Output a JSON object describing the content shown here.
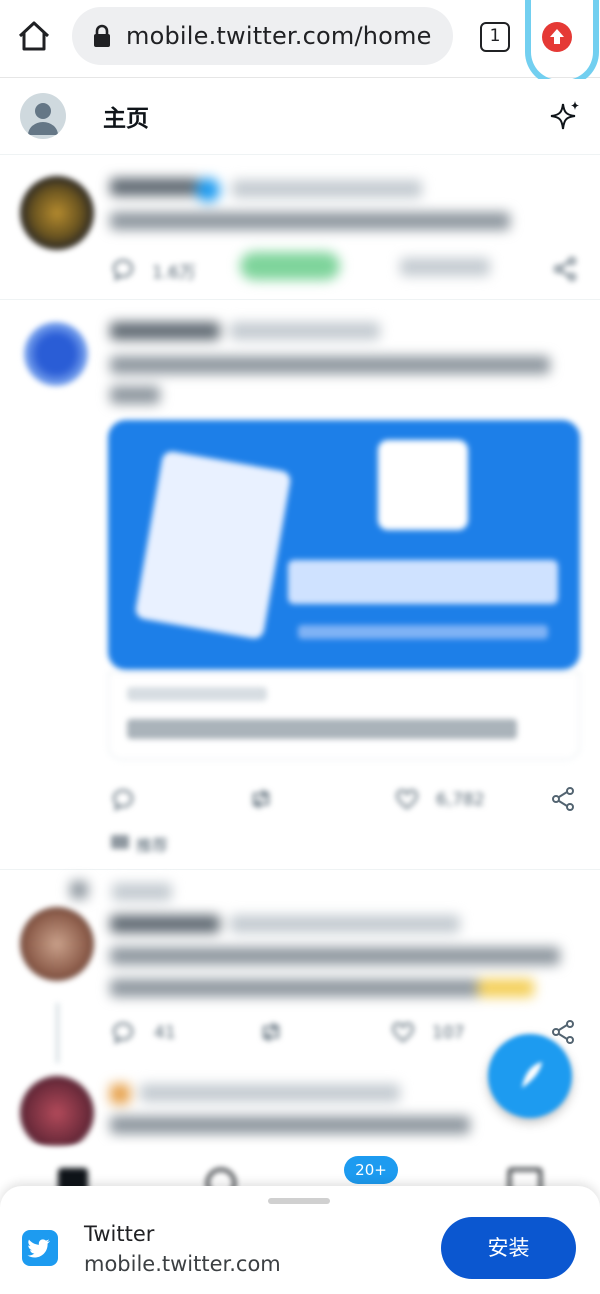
{
  "browser": {
    "url": "mobile.twitter.com/home",
    "tab_count": "1",
    "icons": [
      "home-icon",
      "lock-icon",
      "tabs-icon",
      "extension-update-icon"
    ]
  },
  "header": {
    "title": "主页",
    "icons": [
      "avatar-icon",
      "sparkle-icon"
    ]
  },
  "feed": {
    "tweets": [
      {
        "reply_count": "1.6万"
      },
      {
        "like_count": "6,782",
        "promoted_label": "推荐"
      },
      {
        "reply_count": "41",
        "like_count": "107"
      }
    ]
  },
  "bottom_nav": {
    "badge": "20+"
  },
  "install_prompt": {
    "app_name": "Twitter",
    "app_url": "mobile.twitter.com",
    "install_label": "安装"
  },
  "colors": {
    "twitter_blue": "#1d9bf0",
    "install_button": "#0b57d0",
    "extension_red": "#e53935",
    "highlight_ring": "#72cff0"
  }
}
